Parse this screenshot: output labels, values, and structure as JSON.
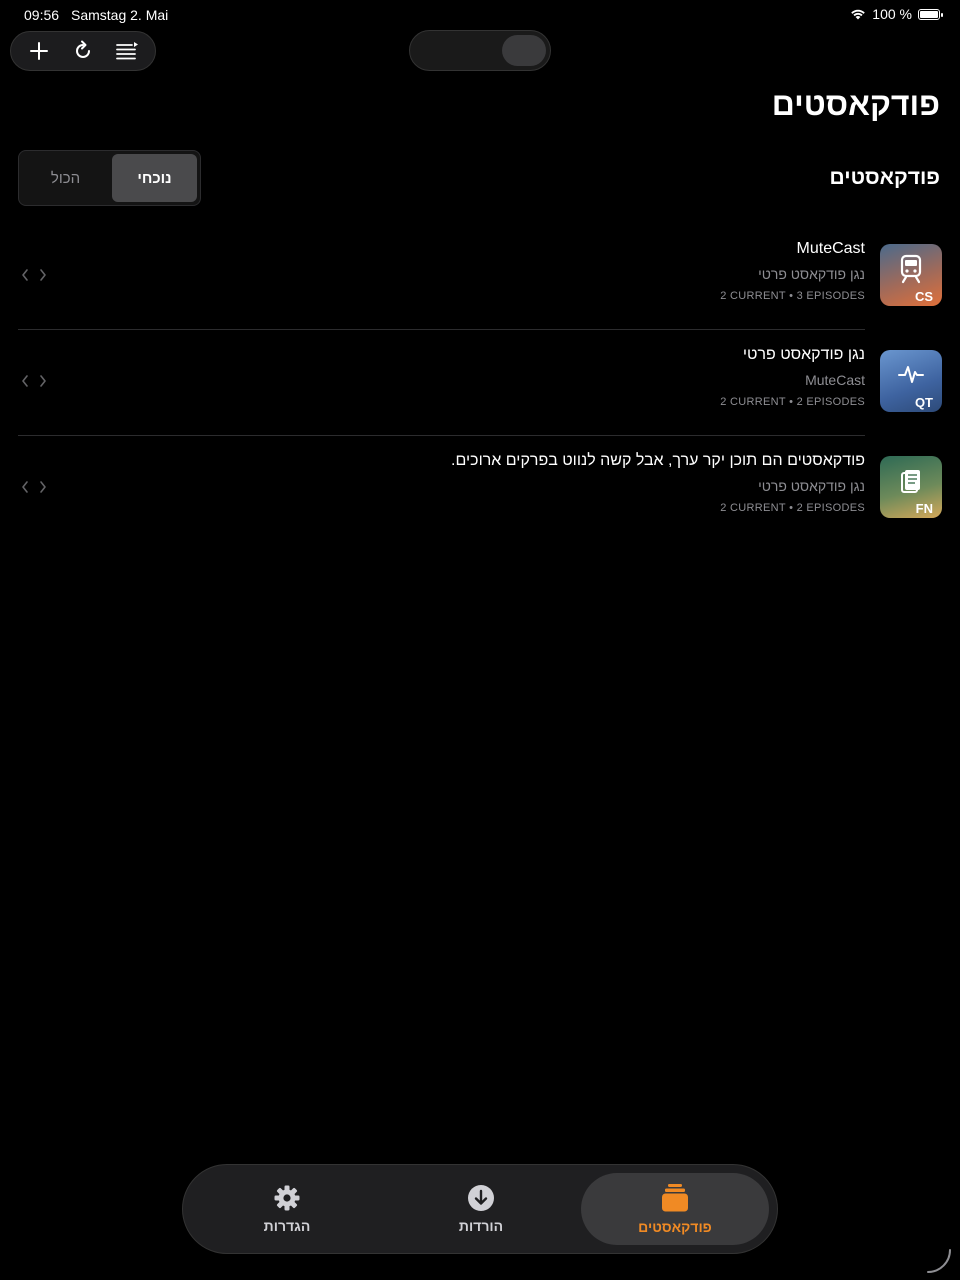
{
  "status_bar": {
    "time": "09:56",
    "date": "Samstag 2. Mai",
    "battery": "100 %"
  },
  "header": {
    "title": "פודקאסטים"
  },
  "section": {
    "title": "פודקאסטים",
    "segments": {
      "current": "נוכחי",
      "all": "הכול"
    }
  },
  "podcasts": [
    {
      "title": "MuteCast",
      "subtitle": "נגן פודקאסט פרטי",
      "meta": "2 CURRENT • 3 EPISODES",
      "art_label": "CS",
      "icon": "train-icon",
      "art_colors": [
        "#4a6a8c",
        "#e0703a"
      ]
    },
    {
      "title": "נגן פודקאסט פרטי",
      "subtitle": "MuteCast",
      "meta": "2 CURRENT • 2 EPISODES",
      "art_label": "QT",
      "icon": "waveform-icon",
      "art_colors": [
        "#5d88c4",
        "#2f4f80"
      ]
    },
    {
      "title": "פודקאסטים הם תוכן יקר ערך, אבל קשה לנווט בפרקים ארוכים.",
      "subtitle": "נגן פודקאסט פרטי",
      "meta": "2 CURRENT • 2 EPISODES",
      "art_label": "FN",
      "icon": "notebook-icon",
      "art_colors": [
        "#3e6e58",
        "#d4a85a"
      ]
    }
  ],
  "tabbar": {
    "podcasts": "פודקאסטים",
    "downloads": "הורדות",
    "settings": "הגדרות"
  },
  "colors": {
    "accent": "#f08a24",
    "background": "#000000"
  }
}
